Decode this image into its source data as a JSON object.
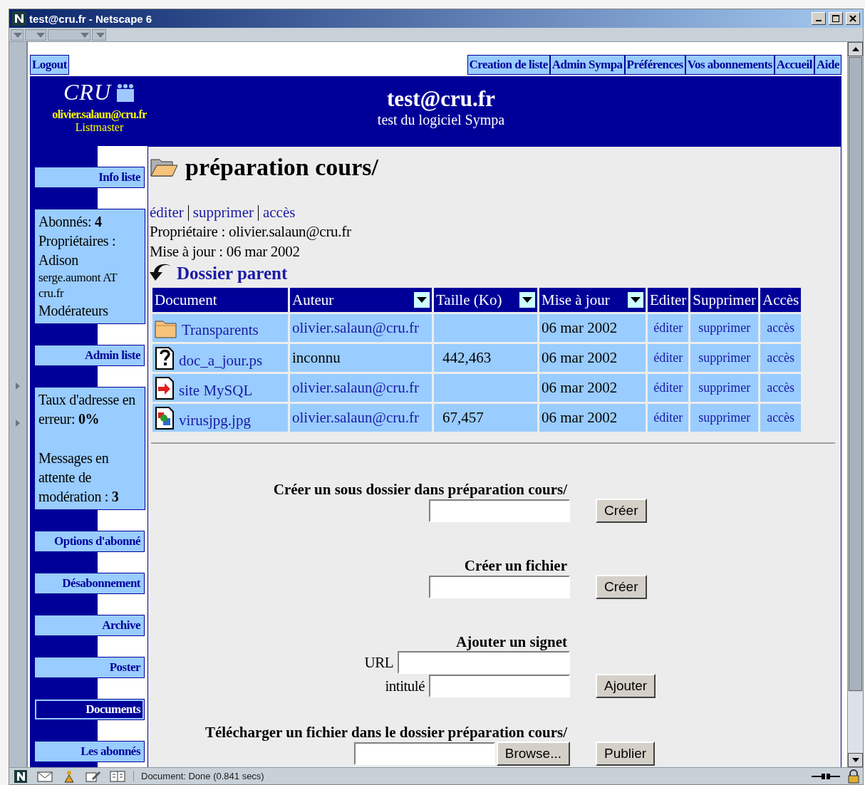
{
  "window": {
    "title": "test@cru.fr - Netscape 6"
  },
  "top_nav": {
    "logout": "Logout",
    "links": [
      "Creation de liste",
      "Admin Sympa",
      "Préférences",
      "Vos abonnements",
      "Accueil",
      "Aide"
    ]
  },
  "header": {
    "logo_text": "CRU",
    "user": "olivier.salaun@cru.fr",
    "role": "Listmaster",
    "list_name": "test@cru.fr",
    "list_subject": "test du logiciel Sympa"
  },
  "sidebar": [
    {
      "kind": "link",
      "label": "Info liste",
      "selected": false
    },
    {
      "kind": "info",
      "groups": [
        [
          "Abonnés: **4**",
          "Propriétaires :",
          "Adison",
          "serge.aumont AT cru.fr",
          "Modérateurs"
        ]
      ]
    },
    {
      "kind": "link",
      "label": "Admin liste",
      "selected": false
    },
    {
      "kind": "info",
      "groups": [
        [
          "Taux d'adresse en erreur: **0%**"
        ],
        [
          "Messages en attente de modération : **3**"
        ]
      ]
    },
    {
      "kind": "link",
      "label": "Options d'abonné",
      "selected": false
    },
    {
      "kind": "link",
      "label": "Désabonnement",
      "selected": false
    },
    {
      "kind": "link",
      "label": "Archive",
      "selected": false
    },
    {
      "kind": "link",
      "label": "Poster",
      "selected": false
    },
    {
      "kind": "link",
      "label": "Documents",
      "selected": true
    },
    {
      "kind": "link",
      "label": "Les abonnés",
      "selected": false
    }
  ],
  "folder": {
    "title": "préparation cours/",
    "actions": [
      "éditer",
      "supprimer",
      "accès"
    ],
    "owner": "Propriétaire : olivier.salaun@cru.fr",
    "updated": "Mise à jour : 06 mar 2002",
    "parent_link": "Dossier parent"
  },
  "table": {
    "columns": [
      {
        "label": "Document",
        "sortable": false
      },
      {
        "label": "Auteur",
        "sortable": true
      },
      {
        "label": "Taille (Ko)",
        "sortable": true
      },
      {
        "label": "Mise à jour",
        "sortable": true
      },
      {
        "label": "Editer",
        "sortable": false
      },
      {
        "label": "Supprimer",
        "sortable": false
      },
      {
        "label": "Accès",
        "sortable": false
      }
    ],
    "rows": [
      {
        "kind": "folder",
        "name": "Transparents",
        "author": "olivier.salaun@cru.fr",
        "author_is_link": true,
        "size": "",
        "date": "06 mar 2002",
        "edit": "éditer",
        "delete": "supprimer",
        "access": "accès"
      },
      {
        "kind": "unknown",
        "name": "doc_a_jour.ps",
        "author": "inconnu",
        "author_is_link": false,
        "size": "442,463",
        "date": "06 mar 2002",
        "edit": "éditer",
        "delete": "supprimer",
        "access": "accès"
      },
      {
        "kind": "url",
        "name": "site MySQL",
        "author": "olivier.salaun@cru.fr",
        "author_is_link": true,
        "size": "",
        "date": "06 mar 2002",
        "edit": "éditer",
        "delete": "supprimer",
        "access": "accès"
      },
      {
        "kind": "image",
        "name": "virusjpg.jpg",
        "author": "olivier.salaun@cru.fr",
        "author_is_link": true,
        "size": "67,457",
        "date": "06 mar 2002",
        "edit": "éditer",
        "delete": "supprimer",
        "access": "accès"
      }
    ]
  },
  "forms": [
    {
      "kind": "single",
      "label": "Créer un sous dossier dans préparation cours/",
      "button": "Créer"
    },
    {
      "kind": "single",
      "label": "Créer un fichier",
      "button": "Créer"
    },
    {
      "kind": "bookmark",
      "label": "Ajouter un signet",
      "fields": [
        "URL",
        "intitulé"
      ],
      "button": "Ajouter"
    },
    {
      "kind": "upload",
      "label": "Télécharger un fichier dans le dossier préparation cours/",
      "browse": "Browse...",
      "button": "Publier"
    }
  ],
  "status_bar": {
    "text": "Document: Done (0.841 secs)"
  }
}
